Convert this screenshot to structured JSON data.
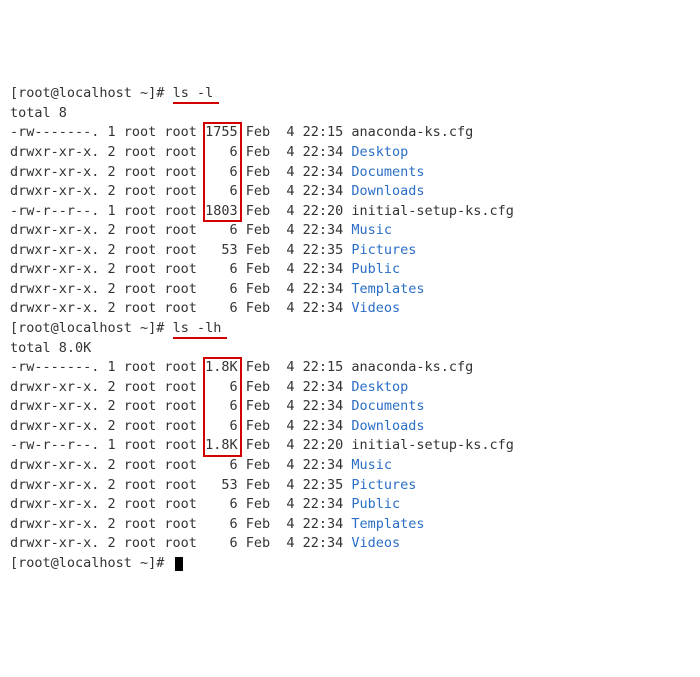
{
  "prompt": "[root@localhost ~]# ",
  "prompt_trunc": "[root@localhost  ~]# ",
  "commands": {
    "ls_l": "ls -l",
    "ls_lh": "ls -lh"
  },
  "totals": {
    "plain": "total 8",
    "human": "total 8.0K"
  },
  "listing_l": [
    {
      "perm": "-rw-------.",
      "links": "1",
      "owner": "root",
      "group": "root",
      "size": "1755",
      "month": "Feb",
      "day": "4",
      "time": "22:15",
      "name": "anaconda-ks.cfg",
      "dir": false
    },
    {
      "perm": "drwxr-xr-x.",
      "links": "2",
      "owner": "root",
      "group": "root",
      "size": "6",
      "month": "Feb",
      "day": "4",
      "time": "22:34",
      "name": "Desktop",
      "dir": true
    },
    {
      "perm": "drwxr-xr-x.",
      "links": "2",
      "owner": "root",
      "group": "root",
      "size": "6",
      "month": "Feb",
      "day": "4",
      "time": "22:34",
      "name": "Documents",
      "dir": true
    },
    {
      "perm": "drwxr-xr-x.",
      "links": "2",
      "owner": "root",
      "group": "root",
      "size": "6",
      "month": "Feb",
      "day": "4",
      "time": "22:34",
      "name": "Downloads",
      "dir": true
    },
    {
      "perm": "-rw-r--r--.",
      "links": "1",
      "owner": "root",
      "group": "root",
      "size": "1803",
      "month": "Feb",
      "day": "4",
      "time": "22:20",
      "name": "initial-setup-ks.cfg",
      "dir": false
    },
    {
      "perm": "drwxr-xr-x.",
      "links": "2",
      "owner": "root",
      "group": "root",
      "size": "6",
      "month": "Feb",
      "day": "4",
      "time": "22:34",
      "name": "Music",
      "dir": true
    },
    {
      "perm": "drwxr-xr-x.",
      "links": "2",
      "owner": "root",
      "group": "root",
      "size": "53",
      "month": "Feb",
      "day": "4",
      "time": "22:35",
      "name": "Pictures",
      "dir": true
    },
    {
      "perm": "drwxr-xr-x.",
      "links": "2",
      "owner": "root",
      "group": "root",
      "size": "6",
      "month": "Feb",
      "day": "4",
      "time": "22:34",
      "name": "Public",
      "dir": true
    },
    {
      "perm": "drwxr-xr-x.",
      "links": "2",
      "owner": "root",
      "group": "root",
      "size": "6",
      "month": "Feb",
      "day": "4",
      "time": "22:34",
      "name": "Templates",
      "dir": true
    },
    {
      "perm": "drwxr-xr-x.",
      "links": "2",
      "owner": "root",
      "group": "root",
      "size": "6",
      "month": "Feb",
      "day": "4",
      "time": "22:34",
      "name": "Videos",
      "dir": true
    }
  ],
  "listing_lh": [
    {
      "perm": "-rw-------.",
      "links": "1",
      "owner": "root",
      "group": "root",
      "size": "1.8K",
      "month": "Feb",
      "day": "4",
      "time": "22:15",
      "name": "anaconda-ks.cfg",
      "dir": false
    },
    {
      "perm": "drwxr-xr-x.",
      "links": "2",
      "owner": "root",
      "group": "root",
      "size": "6",
      "month": "Feb",
      "day": "4",
      "time": "22:34",
      "name": "Desktop",
      "dir": true
    },
    {
      "perm": "drwxr-xr-x.",
      "links": "2",
      "owner": "root",
      "group": "root",
      "size": "6",
      "month": "Feb",
      "day": "4",
      "time": "22:34",
      "name": "Documents",
      "dir": true
    },
    {
      "perm": "drwxr-xr-x.",
      "links": "2",
      "owner": "root",
      "group": "root",
      "size": "6",
      "month": "Feb",
      "day": "4",
      "time": "22:34",
      "name": "Downloads",
      "dir": true
    },
    {
      "perm": "-rw-r--r--.",
      "links": "1",
      "owner": "root",
      "group": "root",
      "size": "1.8K",
      "month": "Feb",
      "day": "4",
      "time": "22:20",
      "name": "initial-setup-ks.cfg",
      "dir": false
    },
    {
      "perm": "drwxr-xr-x.",
      "links": "2",
      "owner": "root",
      "group": "root",
      "size": "6",
      "month": "Feb",
      "day": "4",
      "time": "22:34",
      "name": "Music",
      "dir": true
    },
    {
      "perm": "drwxr-xr-x.",
      "links": "2",
      "owner": "root",
      "group": "root",
      "size": "53",
      "month": "Feb",
      "day": "4",
      "time": "22:35",
      "name": "Pictures",
      "dir": true
    },
    {
      "perm": "drwxr-xr-x.",
      "links": "2",
      "owner": "root",
      "group": "root",
      "size": "6",
      "month": "Feb",
      "day": "4",
      "time": "22:34",
      "name": "Public",
      "dir": true
    },
    {
      "perm": "drwxr-xr-x.",
      "links": "2",
      "owner": "root",
      "group": "root",
      "size": "6",
      "month": "Feb",
      "day": "4",
      "time": "22:34",
      "name": "Templates",
      "dir": true
    },
    {
      "perm": "drwxr-xr-x.",
      "links": "2",
      "owner": "root",
      "group": "root",
      "size": "6",
      "month": "Feb",
      "day": "4",
      "time": "22:34",
      "name": "Videos",
      "dir": true
    }
  ],
  "highlights": {
    "cmd1_underline": true,
    "cmd2_underline": true,
    "box1": {
      "rows_from": 0,
      "rows_to": 4
    },
    "box2": {
      "rows_from": 0,
      "rows_to": 4
    }
  }
}
